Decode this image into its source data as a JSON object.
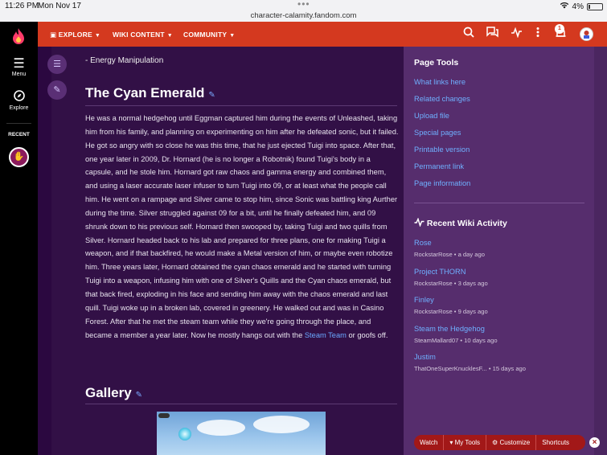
{
  "status_bar": {
    "time": "11:26 PM",
    "date": "Mon Nov 17",
    "url": "character-calamity.fandom.com",
    "battery": "4%"
  },
  "rail": {
    "menu_label": "Menu",
    "explore_label": "Explore",
    "recent_label": "RECENT"
  },
  "topnav": {
    "items": [
      {
        "label": "EXPLORE"
      },
      {
        "label": "WIKI CONTENT"
      },
      {
        "label": "COMMUNITY"
      }
    ],
    "notification_count": "1",
    "icons": [
      "search-icon",
      "discussions-icon",
      "activity-icon",
      "more-icon",
      "notifications-icon",
      "user-avatar"
    ]
  },
  "article": {
    "list_item": "- Energy Manipulation",
    "heading": "The Cyan Emerald",
    "paragraph": "He was a normal hedgehog until Eggman captured him during the events of Unleashed, taking him from his family, and planning on experimenting on him after he defeated sonic, but it failed. He got so angry with so close he was this time, that he just ejected Tuigi into space. After that, one year later in 2009, Dr. Hornard (he is no longer a Robotnik) found Tuigi's body in a capsule, and he stole him. Hornard got raw chaos and gamma energy and combined them, and using a laser accurate laser infuser to turn Tuigi into 09, or at least what the people call him. He went on a rampage and Silver came to stop him, since Sonic was battling king Aurther during the time. Silver struggled against 09 for a bit, until he finally defeated him, and 09 shrunk down to his previous self. Hornard then swooped by, taking Tuigi and two quills from Silver. Hornard headed back to his lab and prepared for three plans, one for making Tuigi a weapon, and if that backfired, he would make a Metal version of him, or maybe even robotize him. Three years later, Hornard obtained the cyan chaos emerald and he started with turning Tuigi into a weapon, infusing him with one of Silver's Quills and the Cyan chaos emerald, but that back fired, exploding in his face and sending him away with the chaos emerald and last quill. Tuigi woke up in a broken lab, covered in greenery. He walked out and was in Casino Forest. After that he met the steam team while they we're going through the place, and became a member a year later. Now he mostly hangs out with the",
    "link_text": "Steam Team",
    "paragraph_end": "or goofs off.",
    "gallery_heading": "Gallery"
  },
  "page_tools": {
    "title": "Page Tools",
    "links": [
      "What links here",
      "Related changes",
      "Upload file",
      "Special pages",
      "Printable version",
      "Permanent link",
      "Page information"
    ]
  },
  "recent_activity": {
    "title": "Recent Wiki Activity",
    "items": [
      {
        "name": "Rose",
        "meta": "RockstarRose • a day ago"
      },
      {
        "name": "Project THORN",
        "meta": "RockstarRose • 3 days ago"
      },
      {
        "name": "Finley",
        "meta": "RockstarRose • 9 days ago"
      },
      {
        "name": "Steam the Hedgehog",
        "meta": "SteamMallard07 • 10 days ago"
      },
      {
        "name": "Justim",
        "meta": "ThatOneSuperKnucklesF... • 15 days ago"
      }
    ]
  },
  "toolbar": {
    "watch": "Watch",
    "my_tools": "My Tools",
    "customize": "Customize",
    "shortcuts": "Shortcuts"
  },
  "colors": {
    "brand_red": "#d4391f",
    "link_blue": "#6fb0ff",
    "content_bg": "#321046",
    "sidebar_bg": "#562d6d"
  }
}
